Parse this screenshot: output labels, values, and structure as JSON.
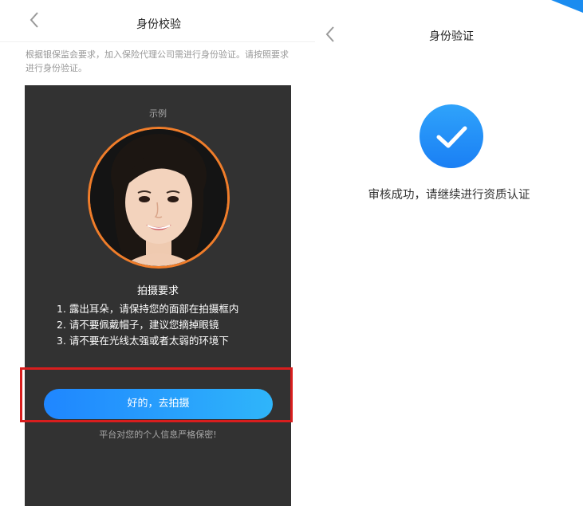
{
  "left_screen": {
    "title": "身份校验",
    "back_icon": "chevron-left-icon",
    "notice_text": "根据银保监会要求，加入保险代理公司需进行身份验证。请按照要求进行身份验证。",
    "sample_label": "示例",
    "requirements_title": "拍摄要求",
    "requirements": [
      "1. 露出耳朵，请保持您的面部在拍摄框内",
      "2. 请不要佩戴帽子，建议您摘掉眼镜",
      "3. 请不要在光线太强或者太弱的环境下"
    ],
    "primary_button": "好的，去拍摄",
    "privacy_text": "平台对您的个人信息严格保密!",
    "colors": {
      "dark_panel": "#323232",
      "avatar_ring": "#f07d2a",
      "button_start": "#1f86ff",
      "button_end": "#2fb5fa",
      "highlight_box": "#d81e1e"
    }
  },
  "right_screen": {
    "title": "身份验证",
    "back_icon": "chevron-left-icon",
    "status_icon": "check-circle-icon",
    "result_text": "审核成功，请继续进行资质认证",
    "colors": {
      "check_circle": "#1a7ff4"
    }
  }
}
